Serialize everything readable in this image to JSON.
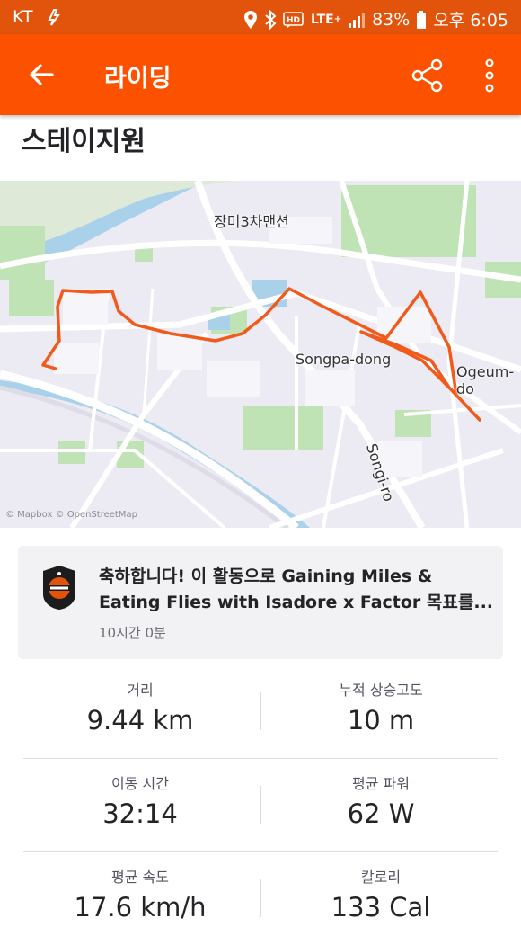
{
  "status_bar": {
    "carrier": "KT",
    "network": "LTE",
    "network_plus": "+",
    "battery": "83%",
    "time": "오후 6:05"
  },
  "app_bar": {
    "title": "라이딩"
  },
  "activity": {
    "name": "스테이지원"
  },
  "map": {
    "labels": {
      "area_1": "장미3차맨션",
      "area_2": "Songpa-dong",
      "area_3": "Ogeum-do",
      "road_1": "Songi-ro"
    },
    "attribution": "© Mapbox © OpenStreetMap",
    "route_color": "#f05a1a"
  },
  "goal": {
    "prefix": "축하합니다! 이 활동으로 ",
    "name": "Gaining Miles & Eating Flies with Isadore x Factor",
    "suffix": " 목표를...",
    "time_ago": "10시간 0분"
  },
  "stats": [
    {
      "label": "거리",
      "value": "9.44 km"
    },
    {
      "label": "누적 상승고도",
      "value": "10 m"
    },
    {
      "label": "이동 시간",
      "value": "32:14"
    },
    {
      "label": "평균 파워",
      "value": "62 W"
    },
    {
      "label": "평균 속도",
      "value": "17.6 km/h"
    },
    {
      "label": "칼로리",
      "value": "133 Cal"
    }
  ],
  "colors": {
    "brand": "#fc5200",
    "status_bar": "#e2540c"
  }
}
